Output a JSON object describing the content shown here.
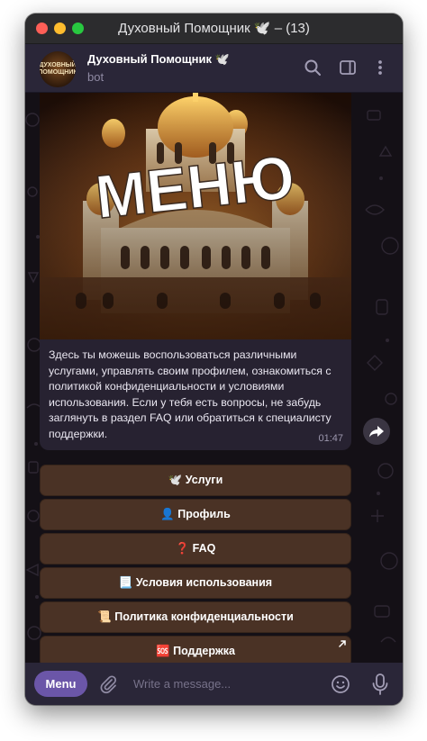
{
  "window": {
    "title": "Духовный Помощник 🕊️ – (13)"
  },
  "chat": {
    "avatar_text": "ДУХОВНЫЙ ПОМОЩНИК",
    "name": "Духовный Помощник 🕊️",
    "subtitle": "bot"
  },
  "header_icons": [
    "search-icon",
    "sidebar-toggle-icon",
    "more-vertical-icon"
  ],
  "message": {
    "image_text": "МЕНЮ",
    "text": "Здесь ты можешь воспользоваться различными услугами, управлять своим профилем, ознакомиться с политикой конфиденциальности и условиями использования. Если у тебя есть вопросы, не забудь заглянуть в раздел FAQ или обратиться к специалисту поддержки.",
    "time": "01:47"
  },
  "keyboard": [
    {
      "label": "🕊️ Услуги"
    },
    {
      "label": "👤 Профиль"
    },
    {
      "label": "❓ FAQ"
    },
    {
      "label": "📃 Условия использования"
    },
    {
      "label": "📜 Политика конфиденциальности"
    },
    {
      "label": "🆘 Поддержка"
    }
  ],
  "composer": {
    "menu_label": "Menu",
    "placeholder": "Write a message..."
  },
  "colors": {
    "accent": "#6b56a8",
    "header_bg": "#2a2638",
    "bubble_bg": "#272231",
    "keyboard_button_bg": "#4a3225"
  }
}
